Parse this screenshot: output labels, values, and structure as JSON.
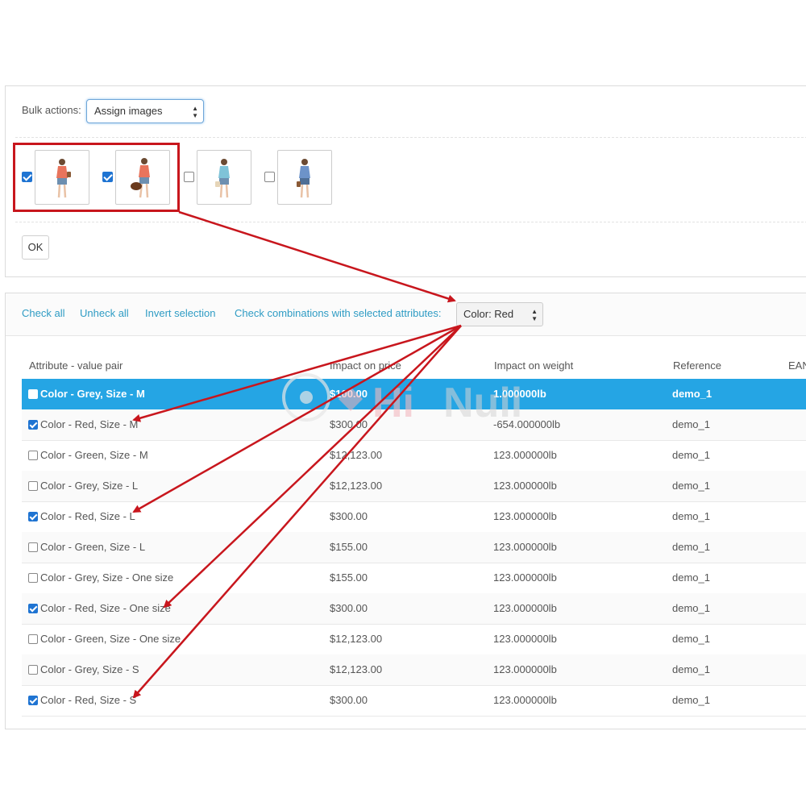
{
  "bulk": {
    "label": "Bulk actions:",
    "selected": "Assign images",
    "ok_label": "OK"
  },
  "images": [
    {
      "checked": true
    },
    {
      "checked": true
    },
    {
      "checked": false
    },
    {
      "checked": false
    }
  ],
  "toolbar": {
    "check_all": "Check all",
    "uncheck_all": "Unheck all",
    "invert": "Invert selection",
    "check_combinations": "Check combinations with selected attributes:",
    "color_selected": "Color: Red"
  },
  "table": {
    "headers": {
      "attribute": "Attribute - value pair",
      "price": "Impact on price",
      "weight": "Impact on weight",
      "reference": "Reference",
      "ean": "EAN"
    },
    "rows": [
      {
        "label": "Color - Grey, Size - M",
        "price": "$100.00",
        "weight": "1.000000lb",
        "reference": "demo_1",
        "checked": false,
        "selected": true
      },
      {
        "label": "Color - Red, Size - M",
        "price": "$300.00",
        "weight": "-654.000000lb",
        "reference": "demo_1",
        "checked": true,
        "selected": false
      },
      {
        "label": "Color - Green, Size - M",
        "price": "$12,123.00",
        "weight": "123.000000lb",
        "reference": "demo_1",
        "checked": false,
        "selected": false
      },
      {
        "label": "Color - Grey, Size - L",
        "price": "$12,123.00",
        "weight": "123.000000lb",
        "reference": "demo_1",
        "checked": false,
        "selected": false
      },
      {
        "label": "Color - Red, Size - L",
        "price": "$300.00",
        "weight": "123.000000lb",
        "reference": "demo_1",
        "checked": true,
        "selected": false
      },
      {
        "label": "Color - Green, Size - L",
        "price": "$155.00",
        "weight": "123.000000lb",
        "reference": "demo_1",
        "checked": false,
        "selected": false
      },
      {
        "label": "Color - Grey, Size - One size",
        "price": "$155.00",
        "weight": "123.000000lb",
        "reference": "demo_1",
        "checked": false,
        "selected": false
      },
      {
        "label": "Color - Red, Size - One size",
        "price": "$300.00",
        "weight": "123.000000lb",
        "reference": "demo_1",
        "checked": true,
        "selected": false
      },
      {
        "label": "Color - Green, Size - One size",
        "price": "$12,123.00",
        "weight": "123.000000lb",
        "reference": "demo_1",
        "checked": false,
        "selected": false
      },
      {
        "label": "Color - Grey, Size - S",
        "price": "$12,123.00",
        "weight": "123.000000lb",
        "reference": "demo_1",
        "checked": false,
        "selected": false
      },
      {
        "label": "Color - Red, Size - S",
        "price": "$300.00",
        "weight": "123.000000lb",
        "reference": "demo_1",
        "checked": true,
        "selected": false
      }
    ]
  },
  "watermark": {
    "text_hi": "Hi",
    "text_nuii": "Nuii"
  },
  "colors": {
    "accent_blue": "#25a5e4",
    "link_blue": "#2f9cc4",
    "annotation_red": "#c8161d"
  }
}
